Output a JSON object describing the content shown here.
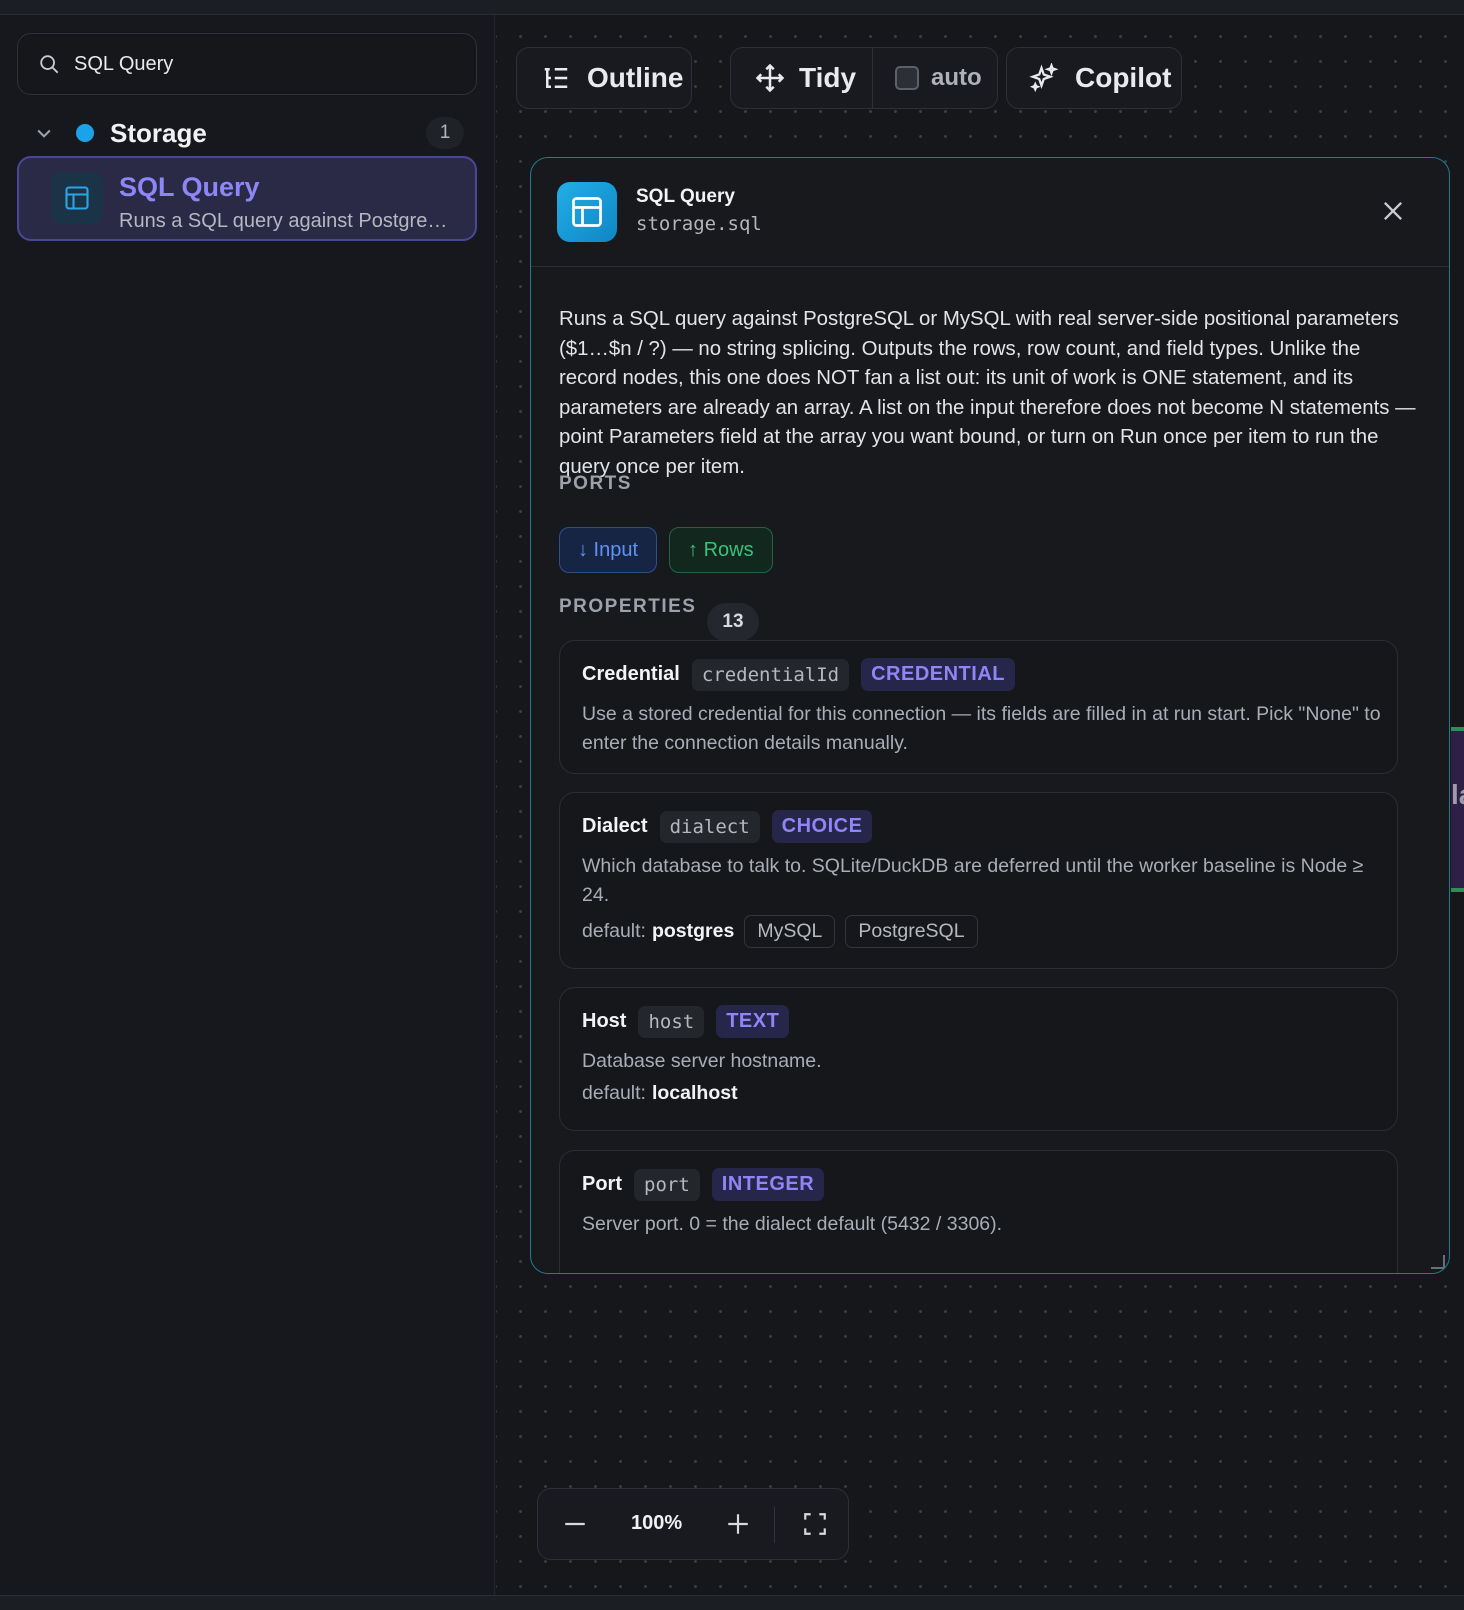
{
  "sidebar": {
    "search_value": "SQL Query",
    "group": {
      "label": "Storage",
      "count": "1",
      "color": "#1aa3e8"
    },
    "item": {
      "title": "SQL Query",
      "subtitle": "Runs a SQL query against PostgreSQ..."
    }
  },
  "toolbar": {
    "outline_label": "Outline",
    "tidy_label": "Tidy",
    "auto_label": "auto",
    "copilot_label": "Copilot"
  },
  "panel": {
    "title": "SQL Query",
    "type_id": "storage.sql",
    "description": "Runs a SQL query against PostgreSQL or MySQL with real server-side positional parameters ($1…$n / ?) — no string splicing. Outputs the rows, row count, and field types. Unlike the record nodes, this one does NOT fan a list out: its unit of work is ONE statement, and its parameters are already an array. A list on the input therefore does not become N statements — point Parameters field at the array you want bound, or turn on Run once per item to run the query once per item.",
    "ports_heading": "PORTS",
    "ports": {
      "input": "↓ Input",
      "rows": "↑ Rows"
    },
    "properties_heading": "PROPERTIES",
    "properties_count": "13",
    "properties": [
      {
        "label": "Credential",
        "key": "credentialId",
        "type": "CREDENTIAL",
        "desc": "Use a stored credential for this connection — its fields are filled in at run start. Pick \"None\" to enter the connection details manually."
      },
      {
        "label": "Dialect",
        "key": "dialect",
        "type": "CHOICE",
        "desc": "Which database to talk to. SQLite/DuckDB are deferred until the worker baseline is Node ≥ 24.",
        "default_prefix": "default:",
        "default": "postgres",
        "options": [
          "MySQL",
          "PostgreSQL"
        ]
      },
      {
        "label": "Host",
        "key": "host",
        "type": "TEXT",
        "desc": "Database server hostname.",
        "default_prefix": "default:",
        "default": "localhost"
      },
      {
        "label": "Port",
        "key": "port",
        "type": "INTEGER",
        "desc": "Server port. 0 = the dialect default (5432 / 3306)."
      }
    ]
  },
  "edge_node_fragment": "la",
  "zoom": {
    "value": "100%"
  }
}
